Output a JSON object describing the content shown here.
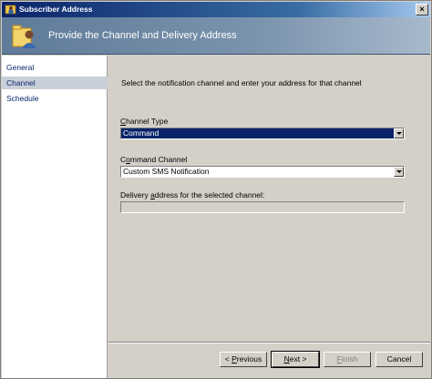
{
  "window": {
    "title": "Subscriber Address",
    "close_glyph": "×"
  },
  "banner": {
    "title": "Provide the Channel and Delivery Address",
    "icon": "user-folder-icon"
  },
  "sidebar": {
    "items": [
      {
        "label": "General",
        "selected": false
      },
      {
        "label": "Channel",
        "selected": true
      },
      {
        "label": "Schedule",
        "selected": false
      }
    ]
  },
  "main": {
    "instruction": "Select the notification channel and enter your address for that channel",
    "channel_type": {
      "label_accel": "C",
      "label_rest": "hannel Type",
      "value": "Command"
    },
    "command_channel": {
      "label_pre": "C",
      "label_accel": "o",
      "label_rest": "mmand Channel",
      "value": "Custom SMS Notification"
    },
    "delivery_address": {
      "label_pre": "Delivery ",
      "label_accel": "a",
      "label_rest": "ddress for the selected channel:",
      "value": ""
    }
  },
  "buttons": {
    "previous": {
      "arrow": "< ",
      "accel": "P",
      "rest": "revious"
    },
    "next": {
      "accel": "N",
      "rest": "ext",
      "arrow": " >"
    },
    "finish": {
      "accel": "F",
      "rest": "inish"
    },
    "cancel": {
      "label": "Cancel"
    }
  },
  "colors": {
    "title_bar": "#0a246a",
    "banner": "#5f7b99",
    "dialog_bg": "#d4d0c8",
    "link": "#0a246a",
    "selection": "#0a246a"
  }
}
